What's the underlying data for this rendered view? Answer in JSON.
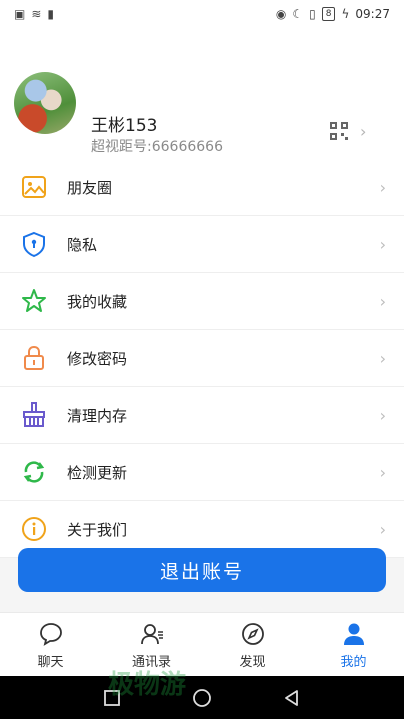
{
  "statusbar": {
    "time": "09:27",
    "battery": "8"
  },
  "profile": {
    "name": "王彬153",
    "id_label": "超视距号:66666666"
  },
  "menu": [
    {
      "label": "朋友圈",
      "icon": "moments-icon",
      "color": "#f0a31a"
    },
    {
      "label": "隐私",
      "icon": "privacy-shield-icon",
      "color": "#1a73e8"
    },
    {
      "label": "我的收藏",
      "icon": "star-icon",
      "color": "#2fb84a"
    },
    {
      "label": "修改密码",
      "icon": "lock-icon",
      "color": "#f08a4b"
    },
    {
      "label": "清理内存",
      "icon": "broom-icon",
      "color": "#6a5acd"
    },
    {
      "label": "检测更新",
      "icon": "refresh-icon",
      "color": "#2fb84a"
    },
    {
      "label": "关于我们",
      "icon": "info-icon",
      "color": "#f0a31a"
    }
  ],
  "logout_label": "退出账号",
  "tabs": [
    {
      "label": "聊天",
      "icon": "chat-icon"
    },
    {
      "label": "通讯录",
      "icon": "contacts-icon"
    },
    {
      "label": "发现",
      "icon": "compass-icon"
    },
    {
      "label": "我的",
      "icon": "profile-icon",
      "active": true
    }
  ],
  "colors": {
    "accent": "#1a73e8"
  },
  "watermark_text": "极物游"
}
